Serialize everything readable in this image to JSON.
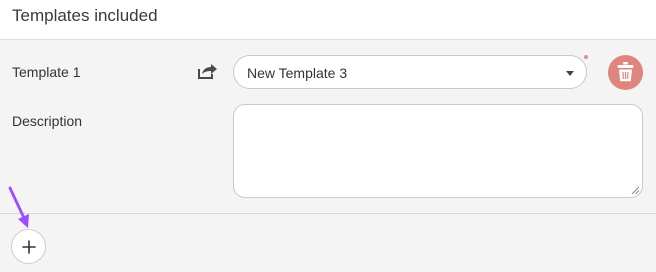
{
  "section": {
    "title": "Templates included"
  },
  "template_row": {
    "label": "Template 1",
    "selected_template": "New Template 3",
    "share_icon": "share-icon",
    "delete_icon": "trash-icon"
  },
  "description_row": {
    "label": "Description",
    "value": ""
  },
  "footer": {
    "add_icon": "plus-icon"
  },
  "colors": {
    "delete_button": "#e0847e",
    "panel_background": "#f4f4f4",
    "annotation_arrow": "#9b4dff",
    "required_dot": "#e88a8a"
  }
}
